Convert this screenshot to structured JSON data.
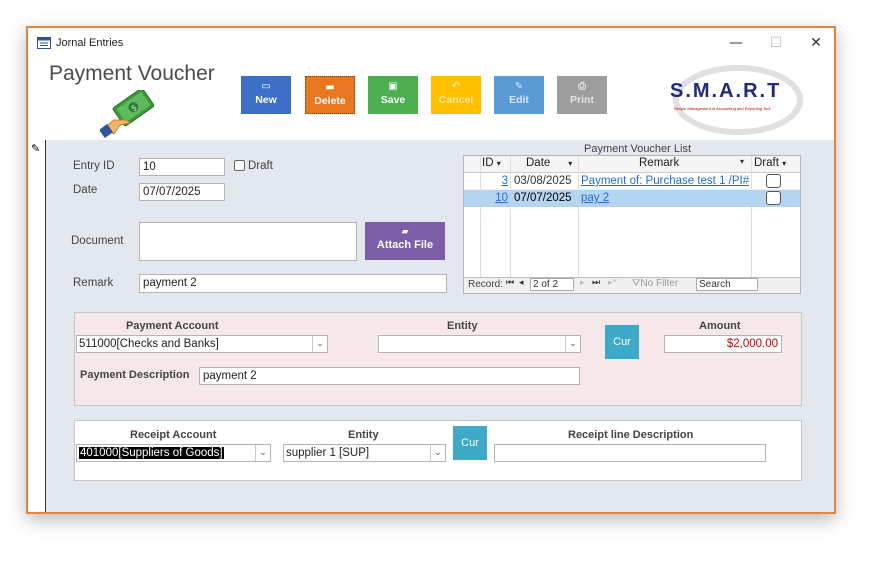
{
  "window": {
    "title": "Jornal Entries",
    "minimize": "—",
    "maximize": "☐",
    "close": "✕"
  },
  "header": {
    "form_title": "Payment Voucher",
    "logo_text": "S.M.A.R.T",
    "logo_subtitle": "Simple Management of Accounting and Reporting Tool"
  },
  "toolbar": {
    "new_label": "New",
    "delete_label": "Delete",
    "save_label": "Save",
    "cancel_label": "Cancel",
    "edit_label": "Edit",
    "print_label": "Print"
  },
  "fields": {
    "entry_id_label": "Entry ID",
    "entry_id_value": "10",
    "draft_label": "Draft",
    "date_label": "Date",
    "date_value": "07/07/2025",
    "document_label": "Document",
    "attach_label": "Attach File",
    "remark_label": "Remark",
    "remark_value": "payment 2"
  },
  "list": {
    "title": "Payment Voucher List",
    "columns": [
      "ID",
      "Date",
      "Remark",
      "Draft"
    ],
    "rows": [
      {
        "id": "3",
        "date": "03/08/2025",
        "remark": "Payment of: Purchase test 1 /PI#"
      },
      {
        "id": "10",
        "date": "07/07/2025",
        "remark": "pay 2"
      }
    ],
    "nav": {
      "record_label": "Record:",
      "position": "2 of 2",
      "filter": "No Filter",
      "search": "Search"
    }
  },
  "payment": {
    "account_label": "Payment Account",
    "account_value": "511000[Checks and Banks]",
    "entity_label": "Entity",
    "entity_value": "",
    "cur_label": "Cur",
    "amount_label": "Amount",
    "amount_value": "$2,000.00",
    "desc_label": "Payment Description",
    "desc_value": "payment 2"
  },
  "receipt": {
    "account_label": "Receipt Account",
    "account_value": "401000[Suppliers of Goods]",
    "entity_label": "Entity",
    "entity_value": "supplier 1 [SUP]",
    "cur_label": "Cur",
    "line_desc_label": "Receipt line Description",
    "line_desc_value": ""
  },
  "colors": {
    "window_border": "#e8813b",
    "new": "#3d6fc8",
    "delete": "#e87722",
    "save": "#4caf50",
    "cancel": "#ffc000",
    "edit": "#5b9bd5",
    "print": "#9e9e9e",
    "attach": "#7b5ea7",
    "cur": "#3fa9c9",
    "amount": "#c00000"
  }
}
